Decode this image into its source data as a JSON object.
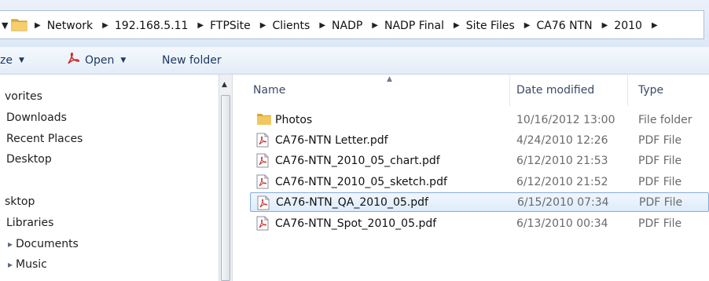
{
  "window": {
    "title": "2010"
  },
  "address_bar": {
    "breadcrumbs": [
      "Network",
      "192.168.5.11",
      "FTPSite",
      "Clients",
      "NADP",
      "NADP Final",
      "Site Files",
      "CA76 NTN",
      "2010"
    ]
  },
  "toolbar": {
    "organize_label": "ze",
    "open_label": "Open",
    "new_folder_label": "New folder"
  },
  "nav_pane": {
    "items": [
      {
        "label": "vorites",
        "icon": "star-icon"
      },
      {
        "label": "Downloads",
        "icon": "downloads-icon"
      },
      {
        "label": "Recent Places",
        "icon": "recent-places-icon"
      },
      {
        "label": "Desktop",
        "icon": "desktop-icon"
      },
      {
        "label": "sktop",
        "icon": "desktop-icon"
      },
      {
        "label": "Libraries",
        "icon": "libraries-icon"
      },
      {
        "label": "Documents",
        "icon": "documents-icon"
      },
      {
        "label": "Music",
        "icon": "music-icon"
      }
    ]
  },
  "columns": {
    "name": "Name",
    "date": "Date modified",
    "type": "Type"
  },
  "files": [
    {
      "name": "Photos",
      "date": "10/16/2012 13:00",
      "type": "File folder",
      "kind": "folder",
      "selected": false
    },
    {
      "name": "CA76-NTN Letter.pdf",
      "date": "4/24/2010 12:26",
      "type": "PDF File",
      "kind": "pdf",
      "selected": false
    },
    {
      "name": "CA76-NTN_2010_05_chart.pdf",
      "date": "6/12/2010 21:53",
      "type": "PDF File",
      "kind": "pdf",
      "selected": false
    },
    {
      "name": "CA76-NTN_2010_05_sketch.pdf",
      "date": "6/12/2010 21:52",
      "type": "PDF File",
      "kind": "pdf",
      "selected": false
    },
    {
      "name": "CA76-NTN_QA_2010_05.pdf",
      "date": "6/15/2010 07:34",
      "type": "PDF File",
      "kind": "pdf",
      "selected": true
    },
    {
      "name": "CA76-NTN_Spot_2010_05.pdf",
      "date": "6/13/2010 00:34",
      "type": "PDF File",
      "kind": "pdf",
      "selected": false
    }
  ],
  "colors": {
    "selection_fill": "#dcebfc",
    "selection_border": "#84acdd",
    "folder": "#e8b84a",
    "pdf_red": "#c8312b"
  }
}
